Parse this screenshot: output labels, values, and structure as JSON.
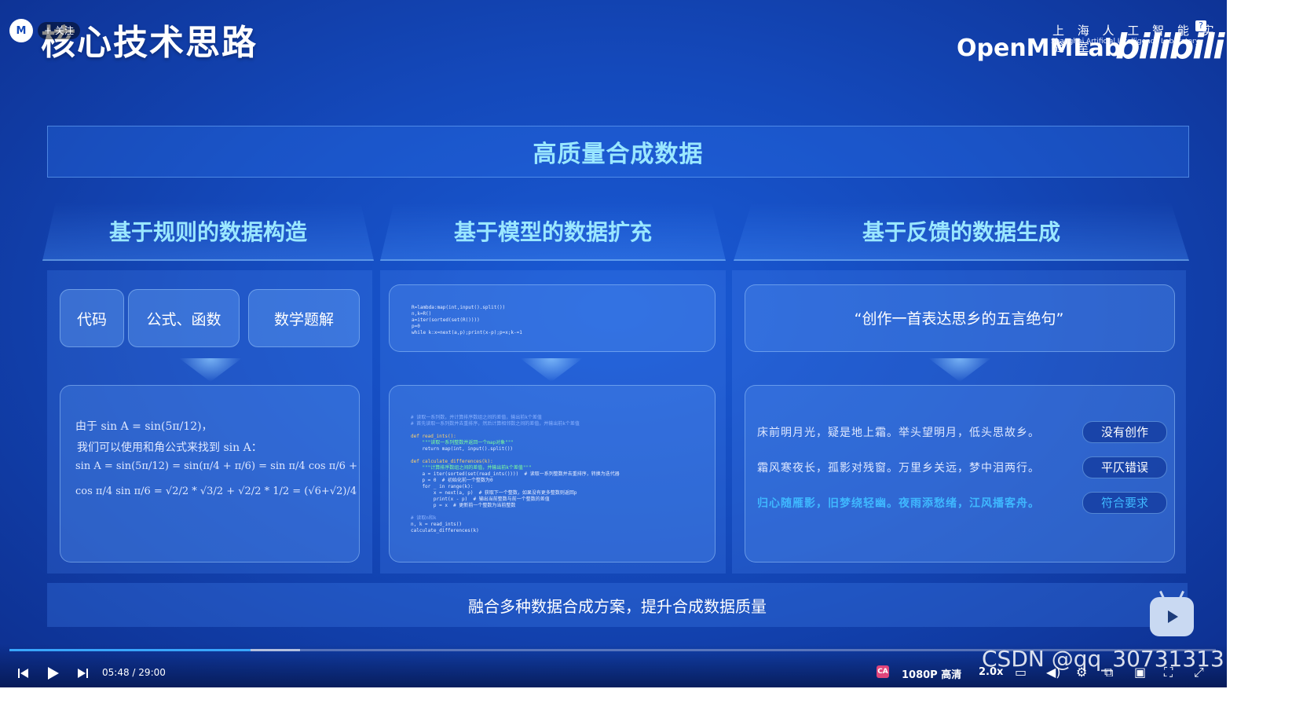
{
  "header": {
    "slide_title": "核心技术思路",
    "follow_label": "+ 关注",
    "avatar_text": "M",
    "logo_zh": "上 海 人 工 智 能 实 验 室",
    "logo_en": "Shanghai Artificial Intelligence Laboratory",
    "logo_main": "OpenMMLab",
    "bili_logo": "bilibili"
  },
  "banner": "高质量合成数据",
  "columns": [
    {
      "title": "基于规则的数据构造"
    },
    {
      "title": "基于模型的数据扩充"
    },
    {
      "title": "基于反馈的数据生成"
    }
  ],
  "rule_col": {
    "pills": [
      "代码",
      "公式、函数",
      "数学题解"
    ],
    "math_lines": [
      "由于 sin A = sin(5π/12)，",
      "我们可以使用和角公式来找到 sin A：",
      "sin A = sin(5π/12) = sin(π/4 + π/6) = sin π/4 cos π/6 +",
      "cos π/4 sin π/6 = √2/2 * √3/2 + √2/2 * 1/2 = (√6+√2)/4"
    ]
  },
  "model_col": {
    "code_top": "R=lambda:map(int,input().split())\nn,k=R()\na=iter(sorted(set(R())))\np=0\nwhile k:x=next(a,p);print(x-p);p=x;k-=1",
    "code_bottom_lines": [
      {
        "t": "# 读取一系列数，并计算排序数组之间的差值，输出前k个差值",
        "c": "cm"
      },
      {
        "t": "# 首先读取一系列数并去重排序，然后计算相邻数之间的差值，并输出前k个差值",
        "c": "cm"
      },
      {
        "t": "",
        "c": ""
      },
      {
        "t": "def read_ints():",
        "c": "kw"
      },
      {
        "t": "    \"\"\"读取一系列整数并返回一个map对象\"\"\"",
        "c": "gr"
      },
      {
        "t": "    return map(int, input().split())",
        "c": ""
      },
      {
        "t": "",
        "c": ""
      },
      {
        "t": "def calculate_differences(k):",
        "c": "kw"
      },
      {
        "t": "    \"\"\"计算排序数组之间的差值，并输出前k个差值\"\"\"",
        "c": "gr"
      },
      {
        "t": "    a = iter(sorted(set(read_ints())))  # 读取一系列整数并去重排序，转换为迭代器",
        "c": ""
      },
      {
        "t": "    p = 0  # 初始化前一个整数为0",
        "c": ""
      },
      {
        "t": "    for _ in range(k):",
        "c": ""
      },
      {
        "t": "        x = next(a, p)  # 获取下一个整数，如果没有更多整数则返回p",
        "c": ""
      },
      {
        "t": "        print(x - p)  # 输出当前整数与前一个整数的差值",
        "c": ""
      },
      {
        "t": "        p = x  # 更新前一个整数为当前整数",
        "c": ""
      },
      {
        "t": "",
        "c": ""
      },
      {
        "t": "# 读取n和k",
        "c": "cm"
      },
      {
        "t": "n, k = read_ints()",
        "c": ""
      },
      {
        "t": "calculate_differences(k)",
        "c": ""
      }
    ]
  },
  "feedback_col": {
    "prompt": "“创作一首表达思乡的五言绝句”",
    "poems": [
      {
        "text": "床前明月光，疑是地上霜。举头望明月，低头思故乡。",
        "tag": "没有创作",
        "good": false
      },
      {
        "text": "霜风寒夜长，孤影对残窗。万里乡关远，梦中泪两行。",
        "tag": "平仄错误",
        "good": false
      },
      {
        "text": "归心随雁影，旧梦绕轻幽。夜雨添愁绪，江风播客舟。",
        "tag": "符合要求",
        "good": true
      }
    ]
  },
  "footer": "融合多种数据合成方案，提升合成数据质量",
  "player": {
    "current_time": "05:48",
    "separator": "/",
    "total_time": "29:00",
    "progress": 0.2,
    "quality": "1080P 高清",
    "speed": "2.0x",
    "watermark": "CSDN @qq_30731313",
    "accent": "#39a6ff"
  }
}
